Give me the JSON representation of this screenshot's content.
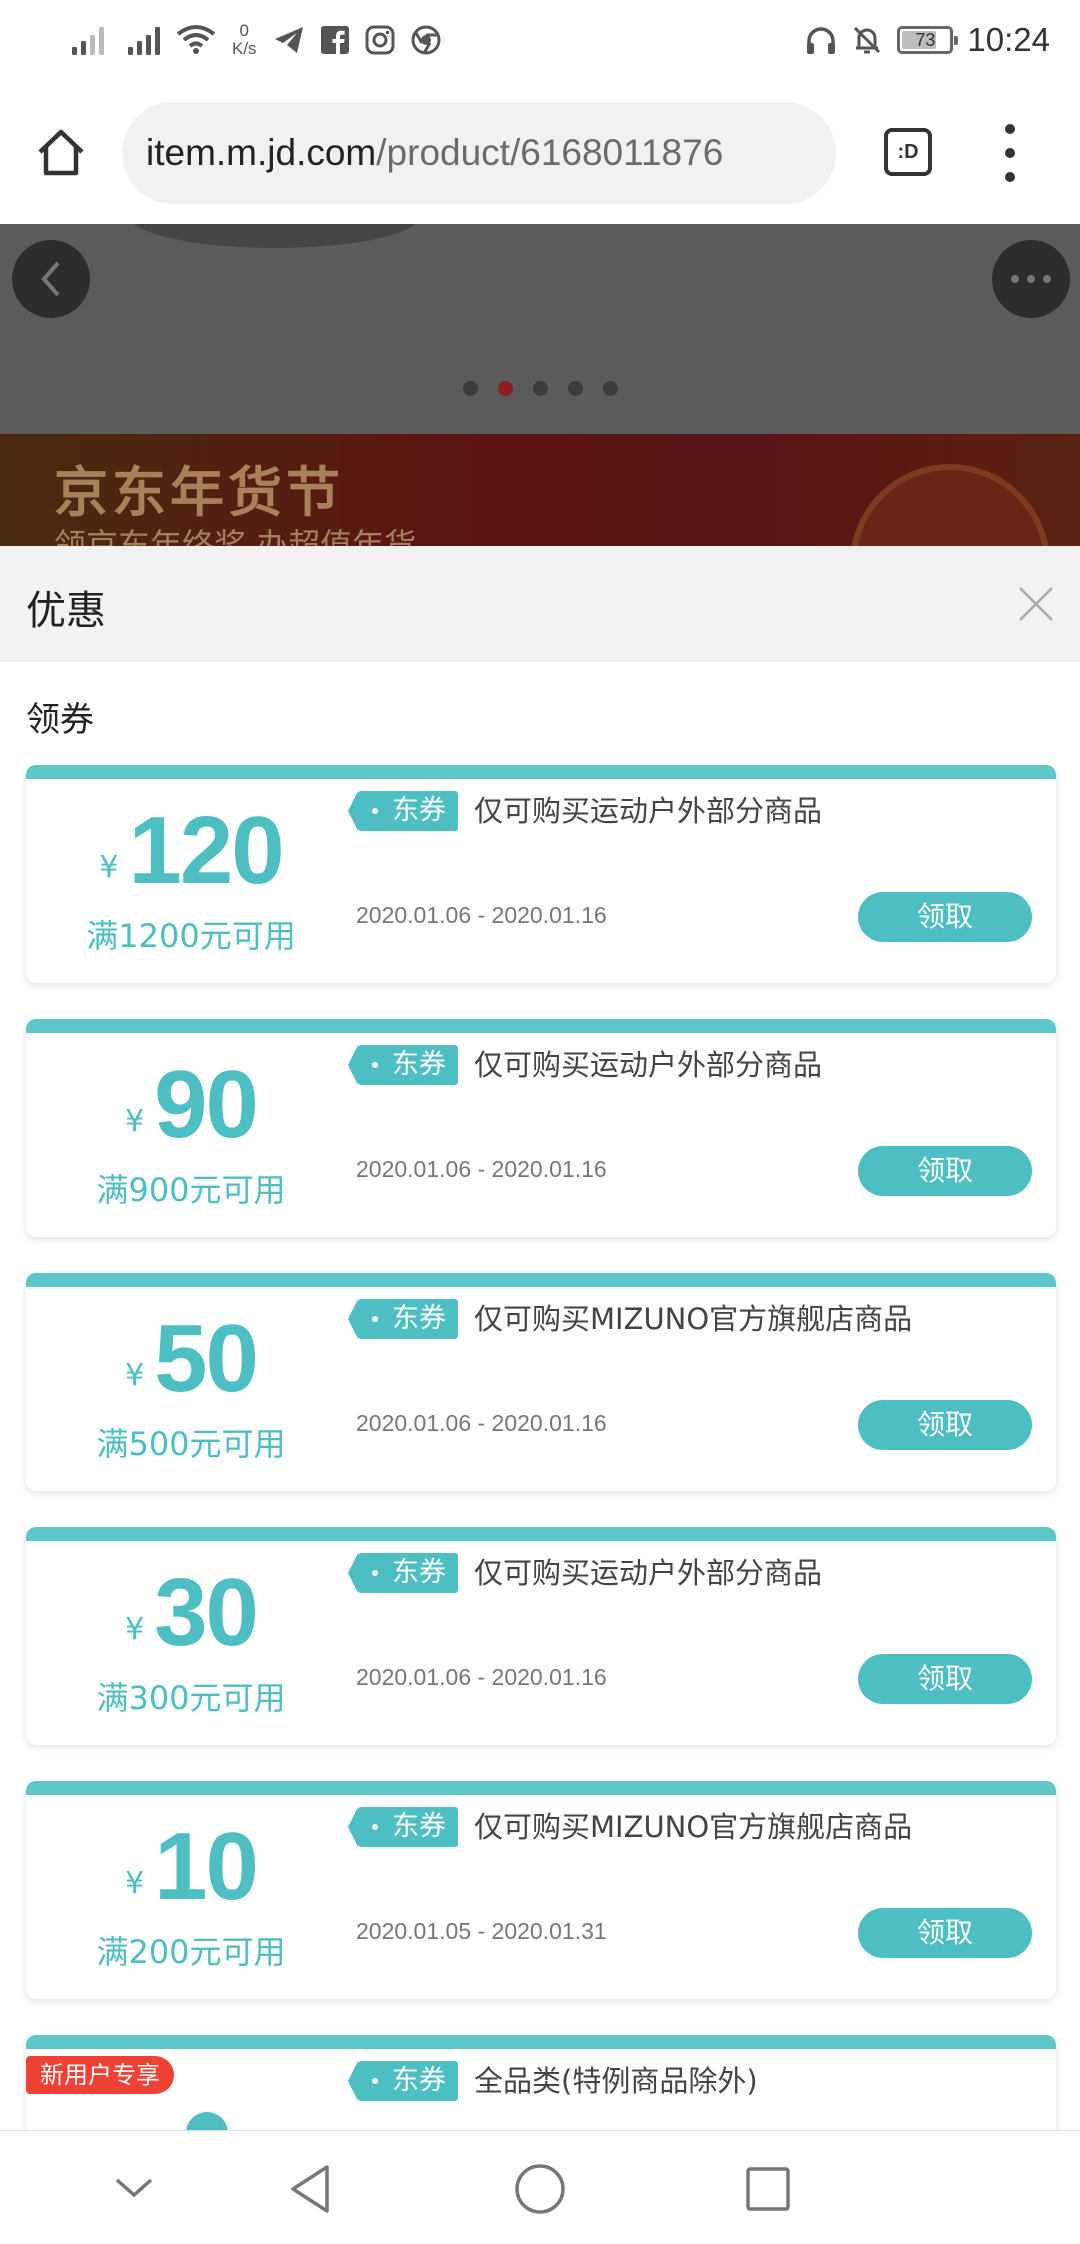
{
  "status_bar": {
    "net_speed_value": "0",
    "net_speed_unit": "K/s",
    "battery_level": 73,
    "battery_label": "73",
    "time": "10:24",
    "icons": [
      "signal-icon",
      "signal-icon",
      "wifi-icon",
      "telegram-icon",
      "facebook-icon",
      "instagram-icon",
      "chrome-icon",
      "headphones-icon",
      "bell-off-icon",
      "battery-icon"
    ]
  },
  "browser": {
    "url_host": "item.m.jd.com",
    "url_path": "/product/6168011876",
    "tab_label": ":D"
  },
  "product": {
    "dots": [
      "dot-1",
      "dot-2",
      "dot-3",
      "dot-4",
      "dot-5"
    ],
    "active_dot": 1
  },
  "banner": {
    "title": "京东年货节",
    "subtitle": "领京东年终奖 办超值年货"
  },
  "sheet": {
    "title": "优惠",
    "section_label": "领券"
  },
  "coupons": [
    {
      "currency": "¥",
      "amount": "120",
      "condition": "满1200元可用",
      "tag": "东券",
      "desc": "仅可购买运动户外部分商品",
      "date": "2020.01.06 - 2020.01.16",
      "button": "领取"
    },
    {
      "currency": "¥",
      "amount": "90",
      "condition": "满900元可用",
      "tag": "东券",
      "desc": "仅可购买运动户外部分商品",
      "date": "2020.01.06 - 2020.01.16",
      "button": "领取"
    },
    {
      "currency": "¥",
      "amount": "50",
      "condition": "满500元可用",
      "tag": "东券",
      "desc": "仅可购买MIZUNO官方旗舰店商品",
      "date": "2020.01.06 - 2020.01.16",
      "button": "领取"
    },
    {
      "currency": "¥",
      "amount": "30",
      "condition": "满300元可用",
      "tag": "东券",
      "desc": "仅可购买运动户外部分商品",
      "date": "2020.01.06 - 2020.01.16",
      "button": "领取"
    },
    {
      "currency": "¥",
      "amount": "10",
      "condition": "满200元可用",
      "tag": "东券",
      "desc": "仅可购买MIZUNO官方旗舰店商品",
      "date": "2020.01.05 - 2020.01.31",
      "button": "领取"
    },
    {
      "tag": "东券",
      "desc": "全品类(特例商品除外)",
      "badge": "新用户专享"
    }
  ],
  "colors": {
    "accent": "#4dbec1",
    "coupon_top": "#5cc6c8",
    "badge_red": "#f04135",
    "active_dot": "#8e1d20"
  },
  "nav": [
    "chevron-down-icon",
    "back-triangle-icon",
    "home-circle-icon",
    "recents-square-icon"
  ]
}
